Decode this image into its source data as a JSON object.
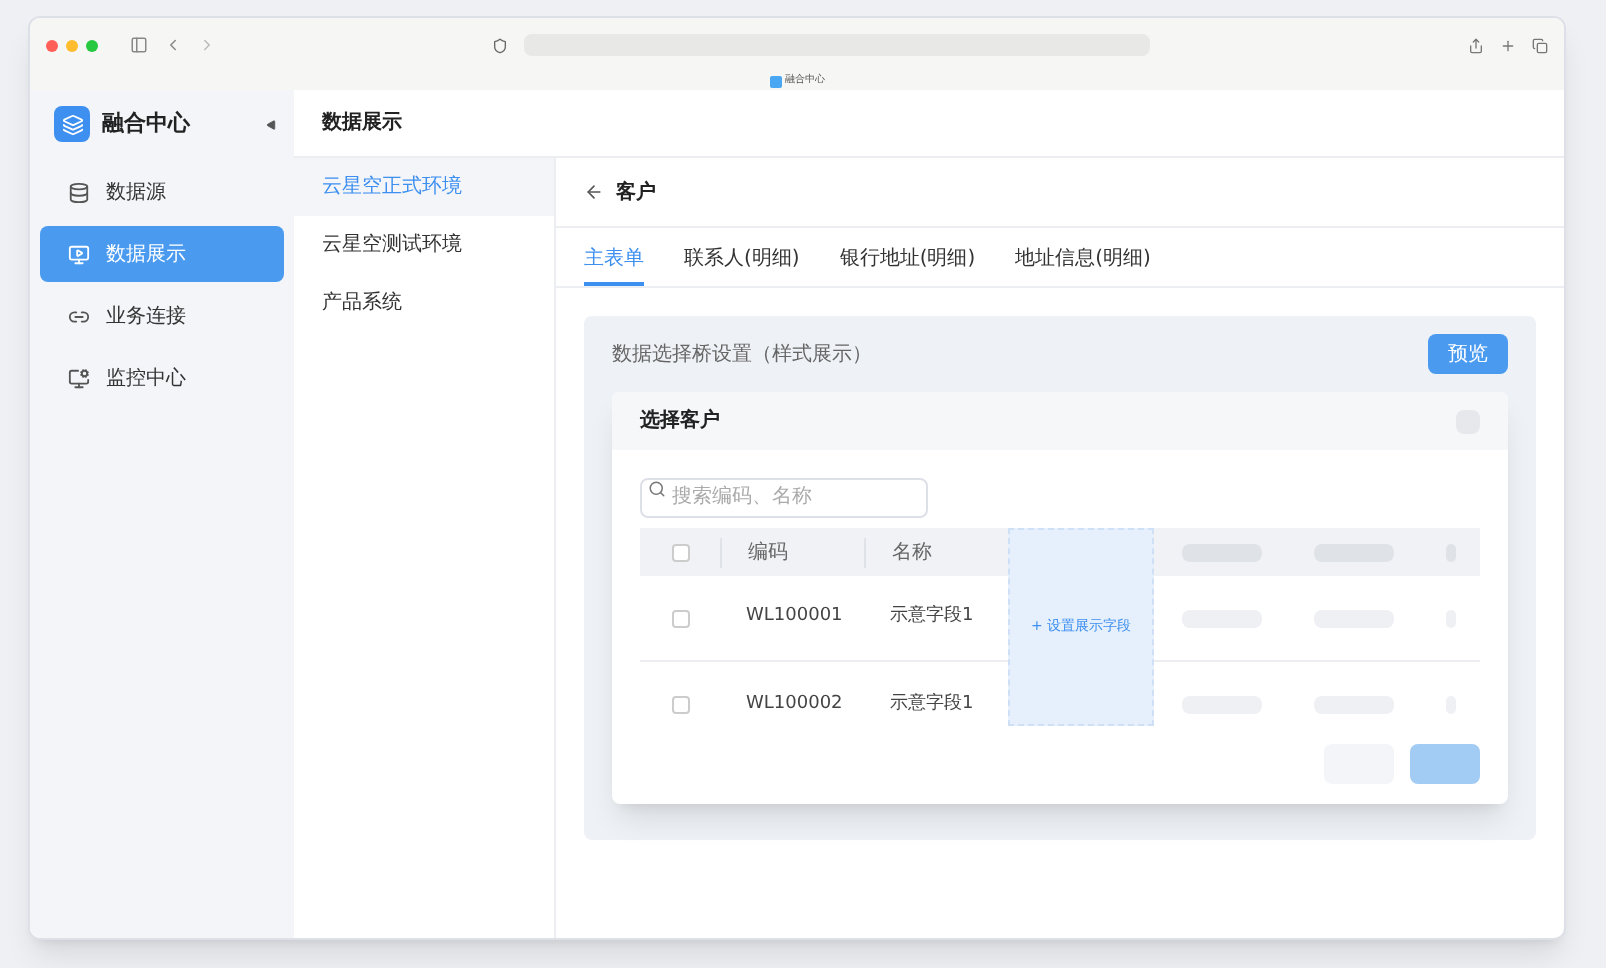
{
  "browser": {
    "tab_title": "融合中心"
  },
  "sidebar": {
    "brand": "融合中心",
    "items": [
      {
        "label": "数据源",
        "selected": false
      },
      {
        "label": "数据展示",
        "selected": true
      },
      {
        "label": "业务连接",
        "selected": false
      },
      {
        "label": "监控中心",
        "selected": false
      }
    ]
  },
  "header": {
    "title": "数据展示"
  },
  "subnav": {
    "items": [
      {
        "label": "云星空正式环境",
        "selected": true
      },
      {
        "label": "云星空测试环境",
        "selected": false
      },
      {
        "label": "产品系统",
        "selected": false
      }
    ]
  },
  "page": {
    "title": "客户",
    "tabs": [
      {
        "label": "主表单",
        "selected": true
      },
      {
        "label": "联系人(明细)",
        "selected": false
      },
      {
        "label": "银行地址(明细)",
        "selected": false
      },
      {
        "label": "地址信息(明细)",
        "selected": false
      }
    ],
    "panel": {
      "title": "数据选择桥设置（样式展示）",
      "button": "预览"
    },
    "dialog": {
      "title": "选择客户",
      "search": {
        "placeholder": "搜索编码、名称"
      },
      "header_checked": false,
      "columns": [
        "编码",
        "名称"
      ],
      "add_field": "+ 设置展示字段",
      "rows": [
        {
          "checked": false,
          "cells": [
            "WL100001",
            "示意字段1"
          ]
        },
        {
          "checked": false,
          "cells": [
            "WL100002",
            "示意字段1"
          ]
        }
      ]
    }
  }
}
